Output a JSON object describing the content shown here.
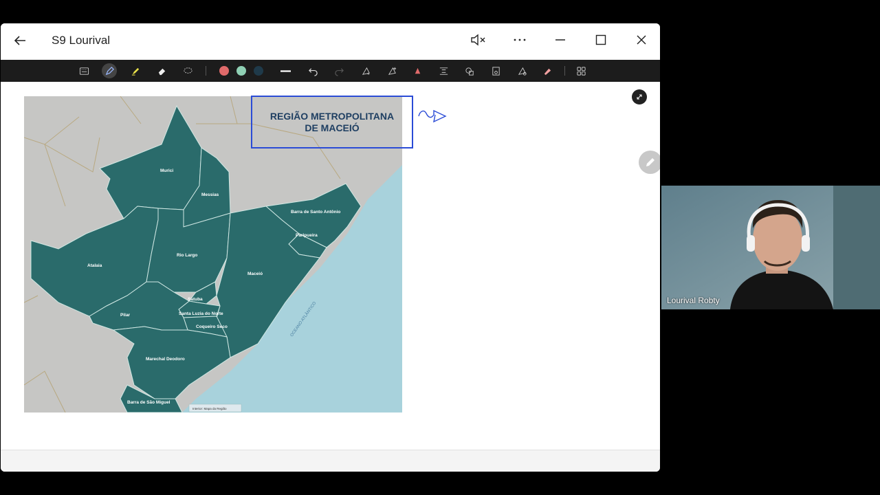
{
  "window": {
    "title": "S9  Lourival"
  },
  "toolbar": {
    "colors": [
      "#e06a6a",
      "#8fd0b4",
      "#1f3a4a"
    ],
    "tools": [
      "text-box",
      "pen",
      "highlighter",
      "eraser",
      "lasso",
      "line-thickness",
      "undo",
      "redo",
      "ink-to-shape",
      "ink-to-text",
      "ruler",
      "math",
      "shapes",
      "lock",
      "replay",
      "clear-ink",
      "more-tools"
    ]
  },
  "map": {
    "title_line1": "REGIÃO METROPOLITANA",
    "title_line2": "DE MACEIÓ",
    "municipalities": {
      "murici": "Murici",
      "messias": "Messias",
      "barra_santo_antonio": "Barra de Santo Antônio",
      "paripueira": "Paripueira",
      "atalaia": "Atalaia",
      "rio_largo": "Rio Largo",
      "maceio": "Maceió",
      "satuba": "Satuba",
      "santa_luzia": "Santa Luzia do Norte",
      "coqueiro_seco": "Coqueiro Seco",
      "pilar": "Pilar",
      "marechal_deodoro": "Marechal Deodoro",
      "barra_sao_miguel": "Barra de São Miguel"
    },
    "ocean_label": "OCEANO ATLÂNTICO",
    "source": "Interior: Mapa da Região"
  },
  "video": {
    "participant_name": "Lourival Robty"
  }
}
